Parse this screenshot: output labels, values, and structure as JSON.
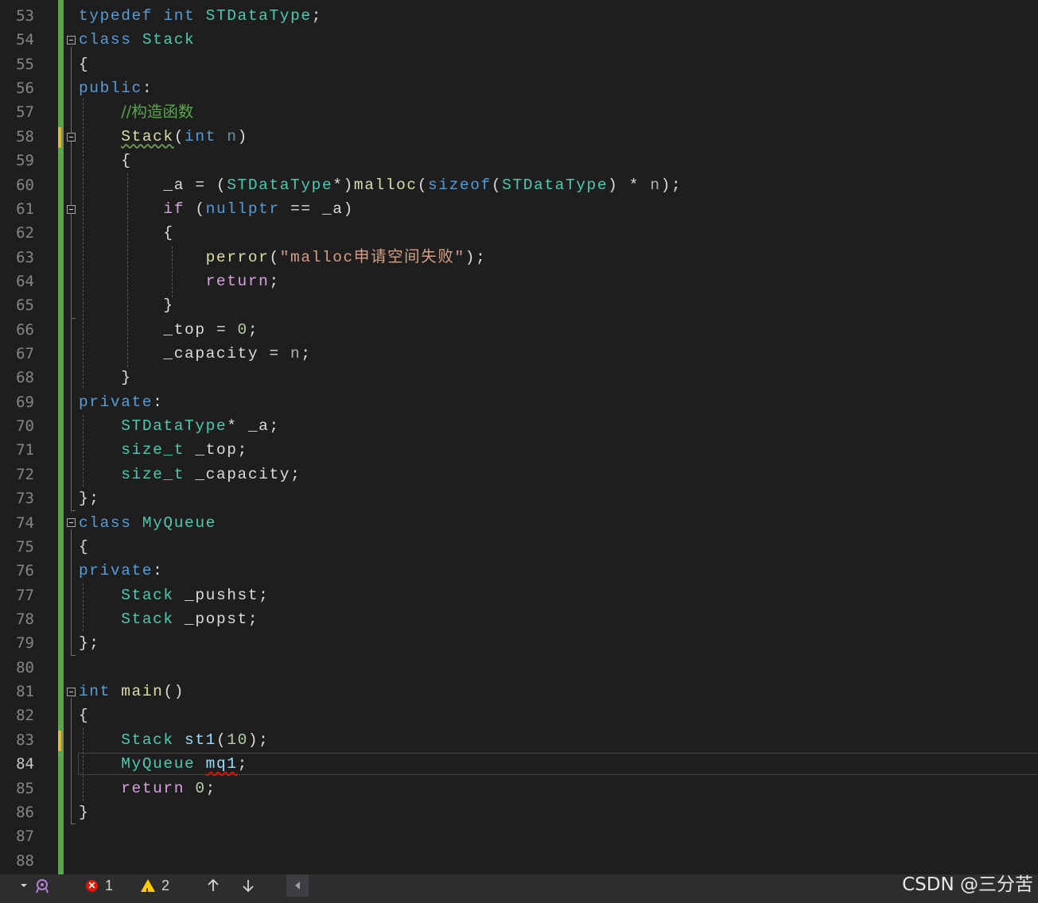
{
  "editor": {
    "current_line": "84",
    "lines": [
      {
        "n": "53"
      },
      {
        "n": "54"
      },
      {
        "n": "55"
      },
      {
        "n": "56"
      },
      {
        "n": "57"
      },
      {
        "n": "58"
      },
      {
        "n": "59"
      },
      {
        "n": "60"
      },
      {
        "n": "61"
      },
      {
        "n": "62"
      },
      {
        "n": "63"
      },
      {
        "n": "64"
      },
      {
        "n": "65"
      },
      {
        "n": "66"
      },
      {
        "n": "67"
      },
      {
        "n": "68"
      },
      {
        "n": "69"
      },
      {
        "n": "70"
      },
      {
        "n": "71"
      },
      {
        "n": "72"
      },
      {
        "n": "73"
      },
      {
        "n": "74"
      },
      {
        "n": "75"
      },
      {
        "n": "76"
      },
      {
        "n": "77"
      },
      {
        "n": "78"
      },
      {
        "n": "79"
      },
      {
        "n": "80"
      },
      {
        "n": "81"
      },
      {
        "n": "82"
      },
      {
        "n": "83"
      },
      {
        "n": "84"
      },
      {
        "n": "85"
      },
      {
        "n": "86"
      },
      {
        "n": "87"
      },
      {
        "n": "88"
      }
    ],
    "tokens": {
      "typedef": "typedef",
      "int": "int",
      "STDataType": "STDataType",
      "class": "class",
      "Stack": "Stack",
      "MyQueue": "MyQueue",
      "public": "public",
      "private": "private",
      "comment_ctor": "//构造函数",
      "n": "n",
      "_a": "_a",
      "malloc": "malloc",
      "sizeof": "sizeof",
      "if": "if",
      "nullptr": "nullptr",
      "perror": "perror",
      "perror_str": "\"malloc申请空间失败\"",
      "return": "return",
      "_top": "_top",
      "_capacity": "_capacity",
      "zero": "0",
      "ten": "10",
      "size_t": "size_t",
      "_pushst": "_pushst",
      "_popst": "_popst",
      "main": "main",
      "st1": "st1",
      "mq1": "mq1"
    }
  },
  "statusbar": {
    "errors": "1",
    "warnings": "2",
    "watermark": "CSDN @三分苦"
  },
  "colors": {
    "background": "#1e1e1e",
    "keyword": "#569cd6",
    "type": "#4ec9b0",
    "function": "#dcdcaa",
    "string": "#d69d85",
    "comment": "#57a64a",
    "control": "#d8a0df",
    "number": "#b5cea8",
    "change_bar": "#57a64a"
  },
  "icons": [
    "collapse-fold-icon",
    "error-icon",
    "warning-icon",
    "up-arrow-icon",
    "down-arrow-icon",
    "scroll-left-icon",
    "dropdown-icon",
    "spy-icon"
  ]
}
